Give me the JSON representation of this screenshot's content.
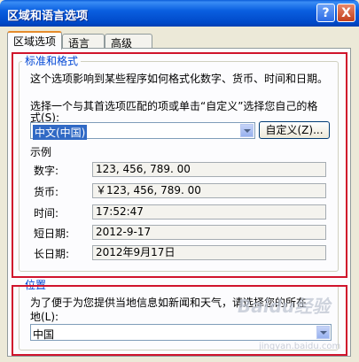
{
  "window": {
    "title": "区域和语言选项",
    "help": "?",
    "close": "X"
  },
  "tabs": [
    "区域选项",
    "语言",
    "高级"
  ],
  "standards": {
    "group_title": "标准和格式",
    "description": "这个选项影响到某些程序如何格式化数字、货币、时间和日期。",
    "select_line1": "选择一个与其首选项匹配的项或单击“自定义”选择您自己的格",
    "select_line2": "式(S):",
    "selected_value": "中文(中国)",
    "custom_button": "自定义(Z)...",
    "samples_label": "示例",
    "samples": [
      {
        "label": "数字:",
        "value": "123, 456, 789. 00"
      },
      {
        "label": "货币:",
        "value": "￥123, 456, 789. 00"
      },
      {
        "label": "时间:",
        "value": "17:52:47"
      },
      {
        "label": "短日期:",
        "value": "2012-9-17"
      },
      {
        "label": "长日期:",
        "value": "2012年9月17日"
      }
    ]
  },
  "location": {
    "group_title": "位置",
    "line1": "为了便于为您提供当地信息如新闻和天气，请选择您的所在",
    "line2": "地(L):",
    "selected_value": "中国"
  },
  "watermark": {
    "brand": "Baidu经验",
    "url": "jingyan.baidu.com"
  },
  "colors": {
    "highlight_box": "#d0142c",
    "title_blue": "#0054e3",
    "group_title": "#0046d5",
    "selection": "#316ac5"
  }
}
